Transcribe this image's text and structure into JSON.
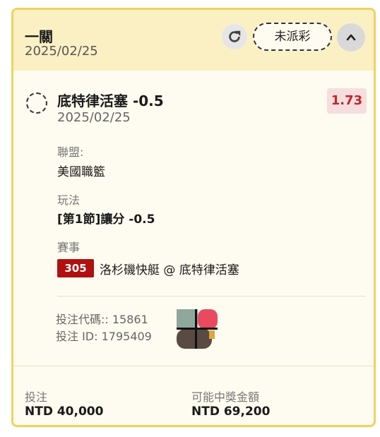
{
  "header": {
    "title": "一關",
    "date": "2025/02/25",
    "status_label": "未派彩"
  },
  "selection": {
    "name": "底特律活塞 -0.5",
    "date": "2025/02/25",
    "odds": "1.73"
  },
  "details": {
    "league_label": "聯盟:",
    "league_value": "美國職籃",
    "market_label": "玩法",
    "market_value": "[第1節]讓分 -0.5",
    "event_label": "賽事",
    "event_number": "305",
    "event_value": "洛杉磯快艇 @ 底特律活塞"
  },
  "codes": {
    "bet_code": "投注代碼:: 15861",
    "bet_id": "投注 ID: 1795409"
  },
  "footer": {
    "stake_label": "投注",
    "stake_value": "NTD 40,000",
    "payout_label": "可能中獎金額",
    "payout_value": "NTD 69,200"
  },
  "colors": {
    "card_border": "#f2d15f",
    "header_bg": "#fbf0c4",
    "odds_text": "#c0272d",
    "badge_bg": "#b01010"
  },
  "icons": [
    "refresh-icon",
    "chevron-up-icon",
    "radio-circle"
  ]
}
